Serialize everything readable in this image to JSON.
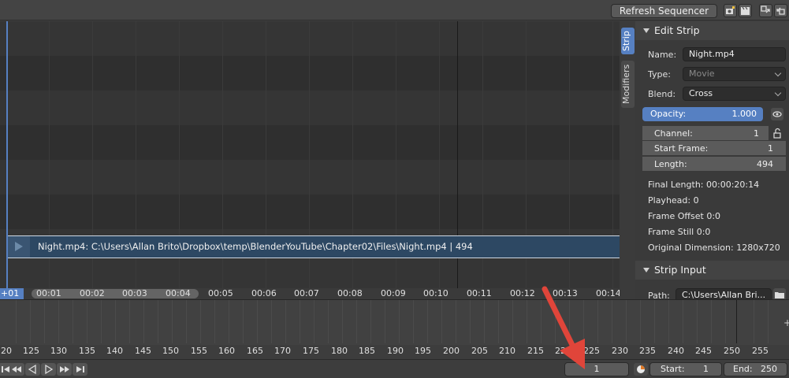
{
  "header": {
    "refresh_label": "Refresh Sequencer"
  },
  "sequencer": {
    "strip_label": "Night.mp4: C:\\Users\\Allan Brito\\Dropbox\\temp\\BlenderYouTube\\Chapter02\\Files\\Night.mp4 | 494",
    "current_frame_badge": "+01",
    "ruler_ticks": [
      "00:01",
      "00:02",
      "00:03",
      "00:04",
      "00:05",
      "00:06",
      "00:07",
      "00:08",
      "00:09",
      "00:10",
      "00:11",
      "00:12",
      "00:13",
      "00:14"
    ]
  },
  "side_tabs": {
    "strip": "Strip",
    "modifiers": "Modifiers"
  },
  "edit_strip": {
    "title": "Edit Strip",
    "name_label": "Name:",
    "name_value": "Night.mp4",
    "type_label": "Type:",
    "type_value": "Movie",
    "blend_label": "Blend:",
    "blend_value": "Cross",
    "opacity_label": "Opacity:",
    "opacity_value": "1.000",
    "channel_label": "Channel:",
    "channel_value": "1",
    "start_frame_label": "Start Frame:",
    "start_frame_value": "1",
    "length_label": "Length:",
    "length_value": "494",
    "final_length": "Final Length: 00:00:20:14",
    "playhead": "Playhead: 0",
    "frame_offset": "Frame Offset 0:0",
    "frame_still": "Frame Still 0:0",
    "original_dimension": "Original Dimension: 1280x720"
  },
  "strip_input": {
    "title": "Strip Input",
    "path_label": "Path:",
    "path_value": "C:\\Users\\Allan Bri..."
  },
  "timeline": {
    "frame_numbers": [
      "20",
      "125",
      "130",
      "135",
      "140",
      "145",
      "150",
      "155",
      "160",
      "165",
      "170",
      "175",
      "180",
      "185",
      "190",
      "195",
      "200",
      "205",
      "210",
      "215",
      "220",
      "225",
      "230",
      "235",
      "240",
      "245",
      "250",
      "255"
    ]
  },
  "bottom_bar": {
    "current_frame": "1",
    "start_label": "Start:",
    "start_value": "1",
    "end_label": "End:",
    "end_value": "250"
  },
  "colors": {
    "accent": "#5680c2",
    "strip": "#2d4863",
    "annotation_arrow": "#e0453a"
  }
}
